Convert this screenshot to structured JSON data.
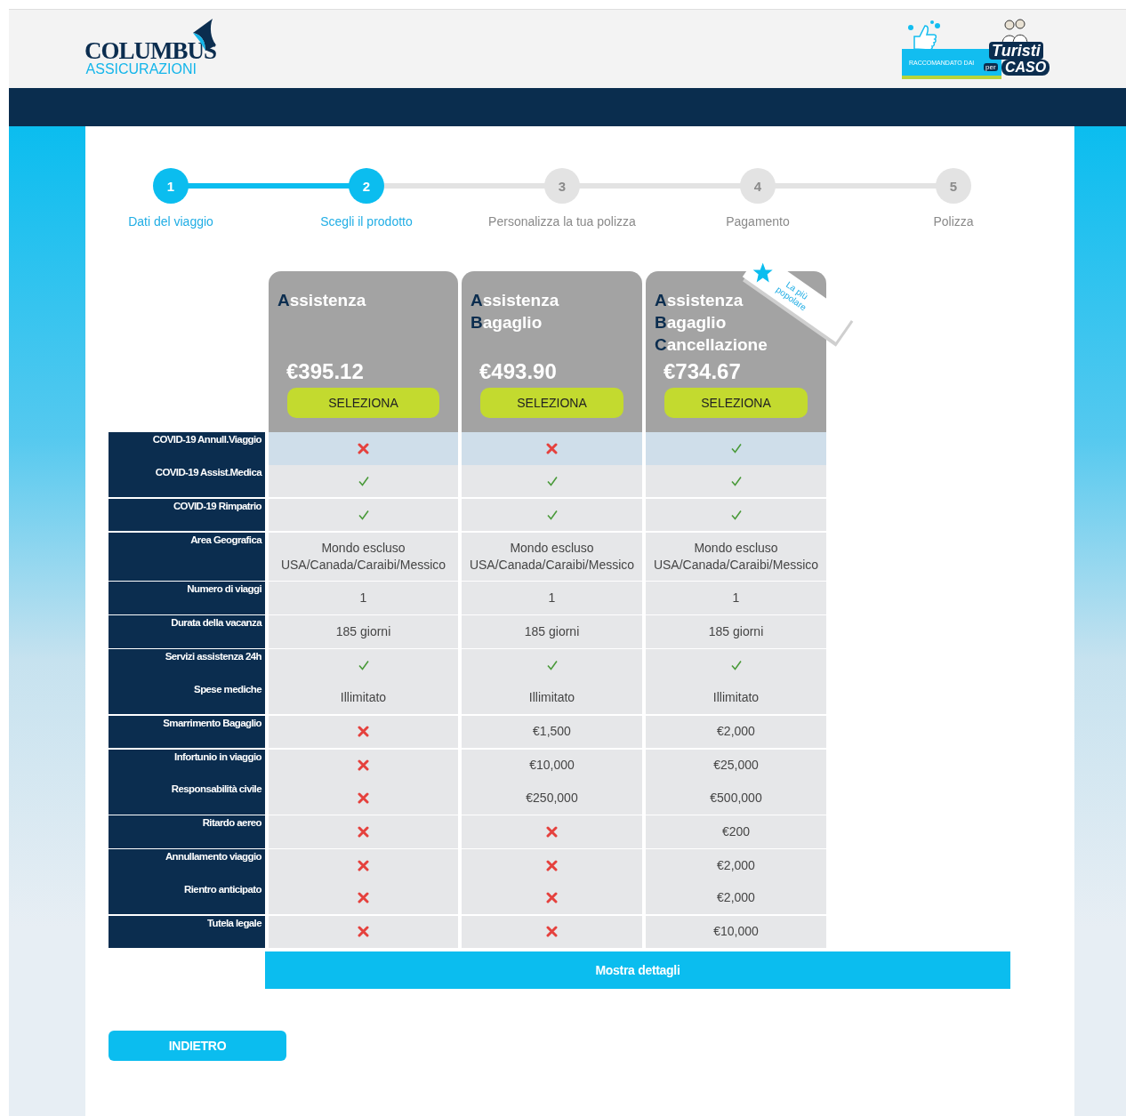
{
  "header": {
    "logo": {
      "name": "COLUMBUS",
      "subtitle": "ASSICURAZIONI"
    },
    "partner": {
      "tagline": "RACCOMANDATO DAI",
      "name": "Turisti",
      "connector": "per",
      "name2": "CASO"
    }
  },
  "steps": [
    {
      "number": "1",
      "label": "Dati del viaggio",
      "completed": true
    },
    {
      "number": "2",
      "label": "Scegli il prodotto",
      "completed": true
    },
    {
      "number": "3",
      "label": "Personalizza la tua polizza",
      "completed": false
    },
    {
      "number": "4",
      "label": "Pagamento",
      "completed": false
    },
    {
      "number": "5",
      "label": "Polizza",
      "completed": false
    }
  ],
  "products": [
    {
      "title_lines": [
        "Assistenza"
      ],
      "price": "€395.12",
      "button": "SELEZIONA"
    },
    {
      "title_lines": [
        "Assistenza",
        "Bagaglio"
      ],
      "price": "€493.90",
      "button": "SELEZIONA"
    },
    {
      "title_lines": [
        "Assistenza",
        "Bagaglio",
        "Cancellazione"
      ],
      "price": "€734.67",
      "button": "SELEZIONA",
      "badge": "La più popolare"
    }
  ],
  "groups": [
    {
      "rows": [
        {
          "label": "COVID-19 Annull.Viaggio",
          "highlighted": true,
          "cells": [
            {
              "kind": "no"
            },
            {
              "kind": "no"
            },
            {
              "kind": "yes"
            }
          ]
        },
        {
          "label": "COVID-19 Assist.Medica",
          "highlighted": false,
          "cells": [
            {
              "kind": "yes"
            },
            {
              "kind": "yes"
            },
            {
              "kind": "yes"
            }
          ]
        }
      ]
    },
    {
      "rows": [
        {
          "label": "COVID-19 Rimpatrio",
          "highlighted": false,
          "cells": [
            {
              "kind": "yes"
            },
            {
              "kind": "yes"
            },
            {
              "kind": "yes"
            }
          ]
        }
      ]
    },
    {
      "rows": [
        {
          "label": "Area Geografica",
          "highlighted": false,
          "cells": [
            {
              "kind": "text",
              "text": "Mondo escluso USA/Canada/Caraibi/Messico"
            },
            {
              "kind": "text",
              "text": "Mondo escluso USA/Canada/Caraibi/Messico"
            },
            {
              "kind": "text",
              "text": "Mondo escluso USA/Canada/Caraibi/Messico"
            }
          ]
        }
      ]
    },
    {
      "rows": [
        {
          "label": "Numero di viaggi",
          "highlighted": false,
          "cells": [
            {
              "kind": "text",
              "text": "1"
            },
            {
              "kind": "text",
              "text": "1"
            },
            {
              "kind": "text",
              "text": "1"
            }
          ]
        }
      ]
    },
    {
      "rows": [
        {
          "label": "Durata della vacanza",
          "highlighted": false,
          "cells": [
            {
              "kind": "text",
              "text": "185 giorni"
            },
            {
              "kind": "text",
              "text": "185 giorni"
            },
            {
              "kind": "text",
              "text": "185 giorni"
            }
          ]
        }
      ]
    },
    {
      "rows": [
        {
          "label": "Servizi assistenza 24h",
          "highlighted": false,
          "cells": [
            {
              "kind": "yes"
            },
            {
              "kind": "yes"
            },
            {
              "kind": "yes"
            }
          ]
        },
        {
          "label": "Spese mediche",
          "highlighted": false,
          "cells": [
            {
              "kind": "text",
              "text": "Illimitato"
            },
            {
              "kind": "text",
              "text": "Illimitato"
            },
            {
              "kind": "text",
              "text": "Illimitato"
            }
          ]
        }
      ]
    },
    {
      "rows": [
        {
          "label": "Smarrimento Bagaglio",
          "highlighted": false,
          "cells": [
            {
              "kind": "no"
            },
            {
              "kind": "text",
              "text": "€1,500"
            },
            {
              "kind": "text",
              "text": "€2,000"
            }
          ]
        }
      ]
    },
    {
      "rows": [
        {
          "label": "Infortunio in viaggio",
          "highlighted": false,
          "cells": [
            {
              "kind": "no"
            },
            {
              "kind": "text",
              "text": "€10,000"
            },
            {
              "kind": "text",
              "text": "€25,000"
            }
          ]
        },
        {
          "label": "Responsabilità civile",
          "highlighted": false,
          "cells": [
            {
              "kind": "no"
            },
            {
              "kind": "text",
              "text": "€250,000"
            },
            {
              "kind": "text",
              "text": "€500,000"
            }
          ]
        }
      ]
    },
    {
      "rows": [
        {
          "label": "Ritardo aereo",
          "highlighted": false,
          "cells": [
            {
              "kind": "no"
            },
            {
              "kind": "no"
            },
            {
              "kind": "text",
              "text": "€200"
            }
          ]
        }
      ]
    },
    {
      "rows": [
        {
          "label": "Annullamento viaggio",
          "highlighted": false,
          "cells": [
            {
              "kind": "no"
            },
            {
              "kind": "no"
            },
            {
              "kind": "text",
              "text": "€2,000"
            }
          ]
        },
        {
          "label": "Rientro anticipato",
          "highlighted": false,
          "cells": [
            {
              "kind": "no"
            },
            {
              "kind": "no"
            },
            {
              "kind": "text",
              "text": "€2,000"
            }
          ]
        }
      ]
    },
    {
      "rows": [
        {
          "label": "Tutela legale",
          "highlighted": false,
          "cells": [
            {
              "kind": "no"
            },
            {
              "kind": "no"
            },
            {
              "kind": "text",
              "text": "€10,000"
            }
          ]
        }
      ]
    }
  ],
  "details_button": "Mostra dettagli",
  "back_button": "INDIETRO"
}
